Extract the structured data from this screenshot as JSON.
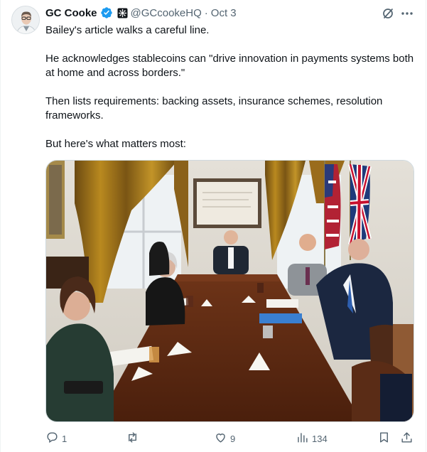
{
  "post": {
    "author_name": "GC Cooke",
    "handle": "@GCcookeHQ",
    "separator": "·",
    "date": "Oct 3",
    "paragraphs": [
      "Bailey's article walks a careful line.",
      "He acknowledges stablecoins can \"drive innovation in payments systems both at home and across borders.\"",
      "Then lists requirements: backing assets, insurance schemes, resolution frameworks.",
      "But here's what matters most:"
    ]
  },
  "icons": {
    "verified": "verified-badge-icon",
    "org": "affiliate-badge-icon",
    "grok": "grok-icon",
    "more": "more-icon",
    "reply": "reply-icon",
    "repost": "repost-icon",
    "like": "like-icon",
    "views": "views-icon",
    "bookmark": "bookmark-icon",
    "share": "share-icon"
  },
  "stats": {
    "replies": "1",
    "reposts": "",
    "likes": "9",
    "views": "134"
  },
  "colors": {
    "verified_blue": "#1d9bf0",
    "text_primary": "#0f1419",
    "text_secondary": "#536471",
    "border": "#cfd9de"
  }
}
